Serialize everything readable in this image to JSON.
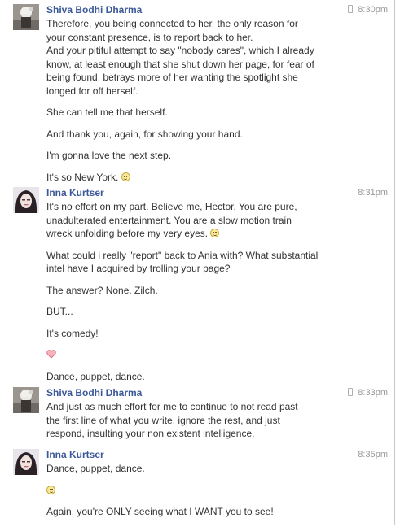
{
  "thread": {
    "messages": [
      {
        "sender": "Shiva Bodhi Dharma",
        "time": "8:30pm",
        "mobile": true,
        "lines": [
          "Therefore, you being connected to her, the only reason for",
          "your constant presence, is to report back to her.",
          "And your pitiful attempt to say \"nobody cares\", which I already",
          "know, at least enough that she shut down her page, for fear of",
          "being found, betrays more of her wanting the spotlight she",
          "longed for off herself.",
          "",
          "She can tell me that herself.",
          "",
          "And thank you, again, for showing your hand.",
          "",
          "I'm gonna love the next step.",
          "",
          "It's so New York."
        ]
      },
      {
        "sender": "Inna Kurtser",
        "time": "8:31pm",
        "mobile": false,
        "lines": [
          "It's no effort on my part. Believe me, Hector. You are pure,",
          "unadulterated entertainment. You are a slow motion train",
          "wreck unfolding before my very eyes.",
          "",
          "What could i really \"report\" back to Ania with? What substantial",
          "intel have I acquired by trolling your page?",
          "",
          "The answer? None. Zilch.",
          "",
          "BUT...",
          "",
          "It's comedy!",
          "",
          "",
          "Dance, puppet, dance."
        ]
      },
      {
        "sender": "Shiva Bodhi Dharma",
        "time": "8:33pm",
        "mobile": true,
        "lines": [
          "And just as much effort for me to continue to not read past",
          "the first line of what you write, ignore the rest, and just",
          "respond, insulting your non existent intelligence."
        ]
      },
      {
        "sender": "Inna Kurtser",
        "time": "8:35pm",
        "mobile": false,
        "lines": [
          "Dance, puppet, dance.",
          "",
          "Again, you're ONLY seeing what I WANT you to see!"
        ]
      }
    ]
  }
}
